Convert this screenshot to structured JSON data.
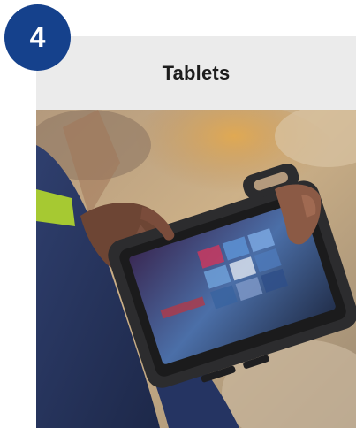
{
  "badge": {
    "number": "4",
    "color": "#15418c"
  },
  "card": {
    "title": "Tablets",
    "background": "#ebebeb"
  },
  "photo": {
    "subject": "rugged-tablet-in-use-icon"
  }
}
